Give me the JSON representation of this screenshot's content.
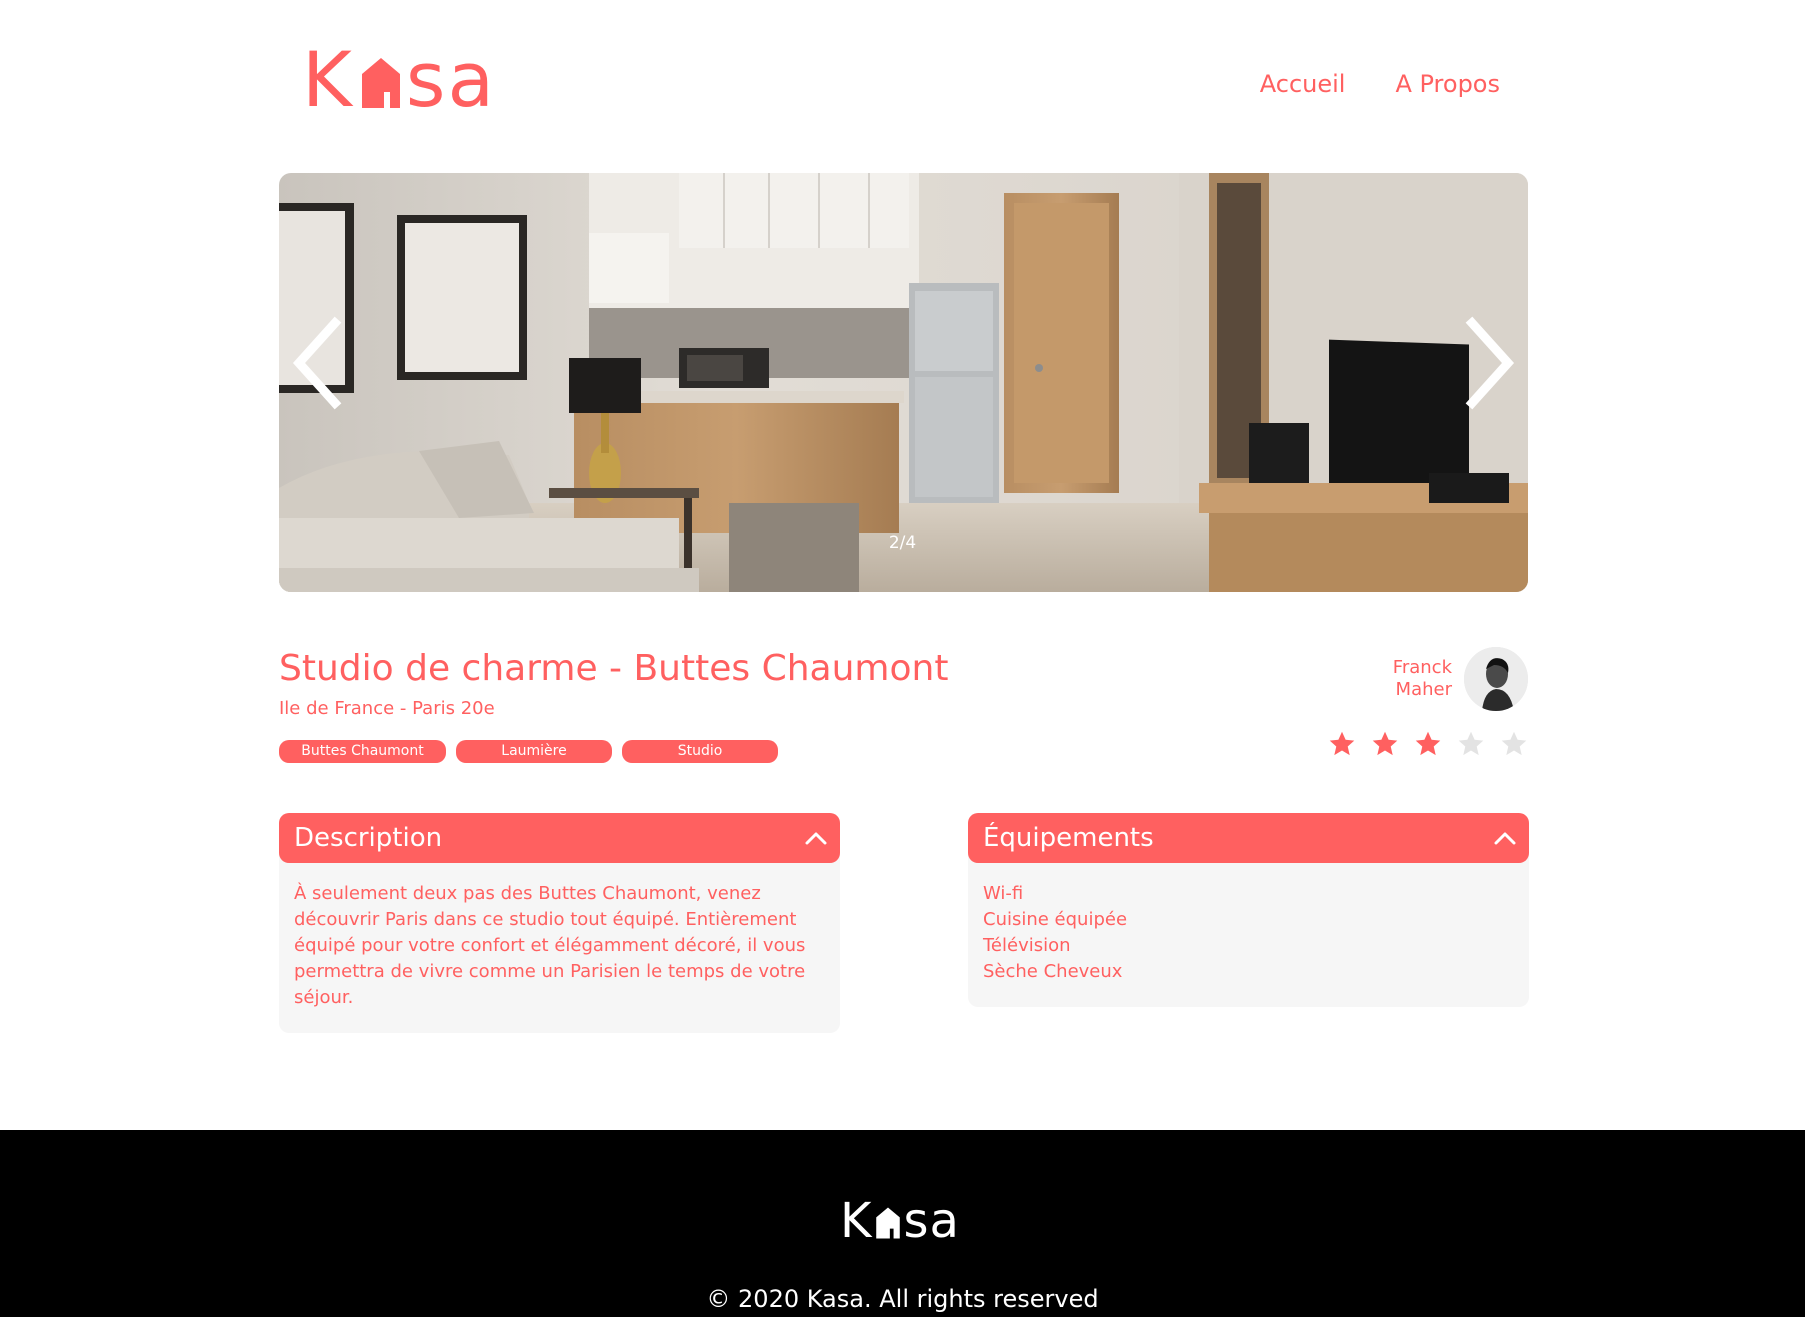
{
  "header": {
    "logo_left": "K",
    "logo_right": "sa",
    "nav": [
      {
        "label": "Accueil"
      },
      {
        "label": "A Propos"
      }
    ]
  },
  "gallery": {
    "counter": "2/4",
    "current_index": 2,
    "total": 4
  },
  "listing": {
    "title": "Studio de charme - Buttes Chaumont",
    "location": "Ile de France - Paris 20e",
    "tags": [
      "Buttes Chaumont",
      "Laumière",
      "Studio"
    ],
    "host": {
      "first_name": "Franck",
      "last_name": "Maher"
    },
    "rating": 3,
    "rating_max": 5
  },
  "description": {
    "title": "Description",
    "text": "À seulement deux pas des Buttes Chaumont, venez découvrir Paris dans ce studio tout équipé. Entièrement équipé pour votre confort et élégamment décoré, il vous permettra de vivre comme un Parisien le temps de votre séjour."
  },
  "equipments": {
    "title": "Équipements",
    "items": [
      "Wi-fi",
      "Cuisine équipée",
      "Télévision",
      "Sèche Cheveux"
    ]
  },
  "footer": {
    "logo_left": "K",
    "logo_right": "sa",
    "copyright": "© 2020 Kasa. All rights reserved"
  },
  "colors": {
    "primary": "#FF6060",
    "panel": "#F6F6F6",
    "star_empty": "#E3E3E3",
    "footer_bg": "#000000"
  }
}
